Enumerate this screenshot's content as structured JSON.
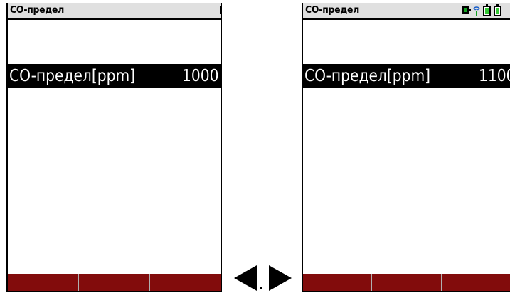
{
  "screens": [
    {
      "title": "CO-предел",
      "parameter": {
        "label": "CO-предел[ppm]",
        "value": "1000"
      },
      "softkeys": [
        "",
        "",
        ""
      ]
    },
    {
      "title": "CO-предел",
      "parameter": {
        "label": "CO-предел[ppm]",
        "value": "1100"
      },
      "softkeys": [
        "",
        "",
        ""
      ]
    }
  ],
  "status_icons": [
    "device-icon",
    "signal-icon",
    "battery-icon",
    "battery-icon"
  ],
  "navigation": [
    "left-arrow-icon",
    "right-arrow-icon"
  ],
  "colors": {
    "title_bar": "#e0e0e0",
    "selected_row": "#000000",
    "selected_text": "#ffffff",
    "softkey": "#820c0c",
    "battery": "#35c835",
    "device_icon": "#10a020"
  }
}
